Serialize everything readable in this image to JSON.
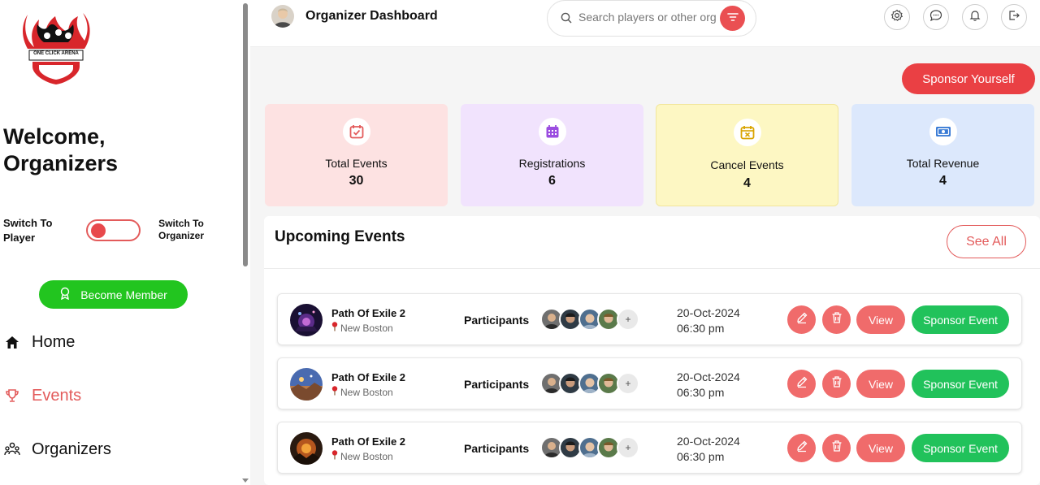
{
  "sidebar": {
    "logo_text": "ONE CLICK ARENA",
    "welcome_line1": "Welcome,",
    "welcome_line2": "Organizers",
    "switch_left": "Switch To Player",
    "switch_right": "Switch To Organizer",
    "become_member": "Become Member",
    "nav": [
      {
        "label": "Home",
        "icon": "home-icon",
        "active": false
      },
      {
        "label": "Events",
        "icon": "trophy-icon",
        "active": true
      },
      {
        "label": "Organizers",
        "icon": "users-icon",
        "active": false
      }
    ]
  },
  "header": {
    "title": "Organizer Dashboard",
    "search_placeholder": "Search players or other org",
    "icons": [
      "settings-icon",
      "chat-icon",
      "bell-icon",
      "logout-icon"
    ]
  },
  "main": {
    "sponsor_yourself": "Sponsor Yourself",
    "stats": [
      {
        "label": "Total Events",
        "value": "30",
        "icon": "calendar-check-icon",
        "bg": "#fde2e2",
        "color": "#e35b5b"
      },
      {
        "label": "Registrations",
        "value": "6",
        "icon": "calendar-grid-icon",
        "bg": "#f1e3fd",
        "color": "#9b4de0"
      },
      {
        "label": "Cancel Events",
        "value": "4",
        "icon": "calendar-x-icon",
        "bg": "#fdf7c3",
        "color": "#d9a400"
      },
      {
        "label": "Total Revenue",
        "value": "4",
        "icon": "money-icon",
        "bg": "#dce8fc",
        "color": "#3a7bd5"
      }
    ],
    "upcoming": {
      "title": "Upcoming Events",
      "see_all": "See All",
      "participants_label": "Participants",
      "more_symbol": "+",
      "view_label": "View",
      "sponsor_label": "Sponsor Event",
      "events": [
        {
          "name": "Path Of Exile 2",
          "location": "New Boston",
          "date": "20-Oct-2024",
          "time": "06:30 pm"
        },
        {
          "name": "Path Of Exile 2",
          "location": "New Boston",
          "date": "20-Oct-2024",
          "time": "06:30 pm"
        },
        {
          "name": "Path Of Exile 2",
          "location": "New Boston",
          "date": "20-Oct-2024",
          "time": "06:30 pm"
        }
      ]
    }
  },
  "colors": {
    "accent": "#ea4044",
    "green": "#21c25b",
    "soft_red": "#f06b6b"
  }
}
